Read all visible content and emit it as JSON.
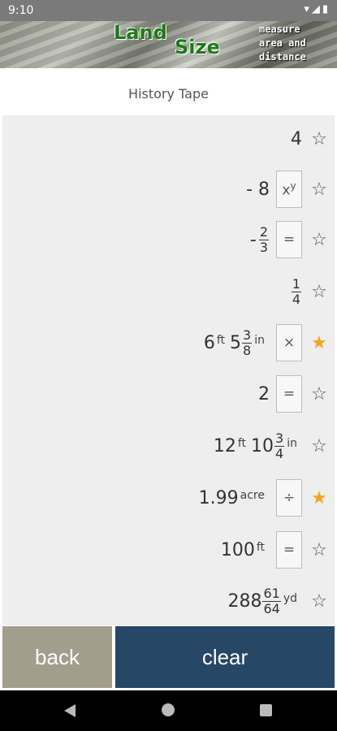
{
  "status": {
    "time": "9:10"
  },
  "banner": {
    "logo_line1": "Land",
    "logo_line2": "Size",
    "tagline": [
      "measure",
      "area and",
      "distance"
    ]
  },
  "header": {
    "title": "History Tape"
  },
  "tape": {
    "rows": [
      {
        "parts": [
          {
            "t": "n",
            "v": "4"
          }
        ],
        "op": null,
        "starred": false
      },
      {
        "parts": [
          {
            "t": "n",
            "v": "- 8"
          }
        ],
        "op": "x^y",
        "starred": false
      },
      {
        "parts": [
          {
            "t": "s",
            "v": "-"
          },
          {
            "t": "f",
            "num": "2",
            "den": "3"
          }
        ],
        "op": "=",
        "starred": false
      },
      {
        "parts": [
          {
            "t": "f",
            "num": "1",
            "den": "4"
          }
        ],
        "op": null,
        "starred": false
      },
      {
        "parts": [
          {
            "t": "n",
            "v": "6"
          },
          {
            "t": "u",
            "v": "ft"
          },
          {
            "t": "n",
            "v": "5"
          },
          {
            "t": "f",
            "num": "3",
            "den": "8"
          },
          {
            "t": "u",
            "v": "in"
          }
        ],
        "op": "×",
        "starred": true
      },
      {
        "parts": [
          {
            "t": "n",
            "v": "2"
          }
        ],
        "op": "=",
        "starred": false
      },
      {
        "parts": [
          {
            "t": "n",
            "v": "12"
          },
          {
            "t": "u",
            "v": "ft"
          },
          {
            "t": "n",
            "v": "10"
          },
          {
            "t": "f",
            "num": "3",
            "den": "4"
          },
          {
            "t": "u",
            "v": "in"
          }
        ],
        "op": null,
        "starred": false
      },
      {
        "parts": [
          {
            "t": "n",
            "v": "1.99"
          },
          {
            "t": "u",
            "v": "acre"
          }
        ],
        "op": "÷",
        "starred": true
      },
      {
        "parts": [
          {
            "t": "n",
            "v": "100"
          },
          {
            "t": "u",
            "v": "ft"
          }
        ],
        "op": "=",
        "starred": false
      },
      {
        "parts": [
          {
            "t": "n",
            "v": "288"
          },
          {
            "t": "f",
            "num": "61",
            "den": "64"
          },
          {
            "t": "u",
            "v": "yd"
          }
        ],
        "op": null,
        "starred": false
      }
    ]
  },
  "buttons": {
    "back_label": "back",
    "clear_label": "clear"
  },
  "icons": {
    "star_empty": "☆",
    "star_filled": "★",
    "star_active_color": "#f4a51c"
  }
}
